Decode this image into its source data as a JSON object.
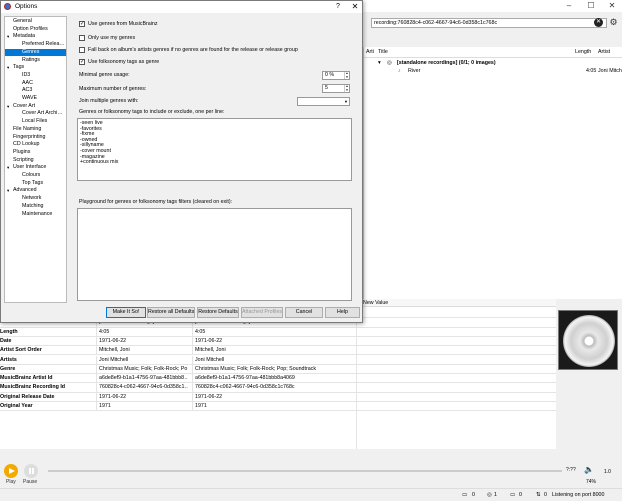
{
  "main": {
    "search_value": "recording:760828c4-c062-4667-94c6-0d358c1c768c",
    "right_columns": [
      "Arti",
      "Title",
      "Length",
      "Artist"
    ],
    "tree_rows": [
      {
        "title": "[standalone recordings] (0/1; 0 images)",
        "length": "",
        "artist": ""
      },
      {
        "title": "River",
        "length": "4:05",
        "artist": "Joni Mitch"
      }
    ],
    "metadata_header_new": "New Value",
    "metadata_rows": [
      {
        "tag": "Artist",
        "orig": "Joni Mitchell",
        "new": "Joni Mitchell"
      },
      {
        "tag": "Album",
        "orig": "[standalone recordings]",
        "new": "[standalone recordings]"
      },
      {
        "tag": "Length",
        "orig": "4:05",
        "new": "4:05"
      },
      {
        "tag": "Date",
        "orig": "1971-06-22",
        "new": "1971-06-22"
      },
      {
        "tag": "Artist Sort Order",
        "orig": "Mitchell, Joni",
        "new": "Mitchell, Joni"
      },
      {
        "tag": "Artists",
        "orig": "Joni Mitchell",
        "new": "Joni Mitchell"
      },
      {
        "tag": "Genre",
        "orig": "Christmas Music; Folk; Folk-Rock; Po…",
        "new": "Christmas Music; Folk; Folk-Rock; Pop; Soundtrack"
      },
      {
        "tag": "MusicBrainz Artist Id",
        "orig": "a6de8ef9-b1a1-4756-97aa-481bbb8…",
        "new": "a6de8ef9-b1a1-4756-97aa-481bbb8a4069"
      },
      {
        "tag": "MusicBrainz Recording Id",
        "orig": "760828c4-c062-4667-94c6-0d358c1…",
        "new": "760828c4-c062-4667-94c6-0d358c1c768c"
      },
      {
        "tag": "Original Release Date",
        "orig": "1971-06-22",
        "new": "1971-06-22"
      },
      {
        "tag": "Original Year",
        "orig": "1971",
        "new": "1971"
      }
    ],
    "player": {
      "play_label": "Play",
      "pause_label": "Pause",
      "time": "?:??",
      "volume": "74%",
      "rate": "1.0"
    },
    "status": {
      "count_a": "0",
      "count_b": "1",
      "count_c": "0",
      "count_d": "0",
      "listening": "Listening on port 8000"
    }
  },
  "dialog": {
    "title": "Options",
    "nav_items": [
      {
        "label": "General",
        "indent": 0,
        "arrow": ""
      },
      {
        "label": "Option Profiles",
        "indent": 0,
        "arrow": ""
      },
      {
        "label": "Metadata",
        "indent": 0,
        "arrow": "▾"
      },
      {
        "label": "Preferred Relea…",
        "indent": 1,
        "arrow": ""
      },
      {
        "label": "Genres",
        "indent": 1,
        "arrow": "",
        "selected": true
      },
      {
        "label": "Ratings",
        "indent": 1,
        "arrow": ""
      },
      {
        "label": "Tags",
        "indent": 0,
        "arrow": "▾"
      },
      {
        "label": "ID3",
        "indent": 1,
        "arrow": ""
      },
      {
        "label": "AAC",
        "indent": 1,
        "arrow": ""
      },
      {
        "label": "AC3",
        "indent": 1,
        "arrow": ""
      },
      {
        "label": "WAVE",
        "indent": 1,
        "arrow": ""
      },
      {
        "label": "Cover Art",
        "indent": 0,
        "arrow": "▾"
      },
      {
        "label": "Cover Art Archi…",
        "indent": 1,
        "arrow": ""
      },
      {
        "label": "Local Files",
        "indent": 1,
        "arrow": ""
      },
      {
        "label": "File Naming",
        "indent": 0,
        "arrow": ""
      },
      {
        "label": "Fingerprinting",
        "indent": 0,
        "arrow": ""
      },
      {
        "label": "CD Lookup",
        "indent": 0,
        "arrow": ""
      },
      {
        "label": "Plugins",
        "indent": 0,
        "arrow": ""
      },
      {
        "label": "Scripting",
        "indent": 0,
        "arrow": ""
      },
      {
        "label": "User Interface",
        "indent": 0,
        "arrow": "▾"
      },
      {
        "label": "Colours",
        "indent": 1,
        "arrow": ""
      },
      {
        "label": "Top Tags",
        "indent": 1,
        "arrow": ""
      },
      {
        "label": "Advanced",
        "indent": 0,
        "arrow": "▾"
      },
      {
        "label": "Network",
        "indent": 1,
        "arrow": ""
      },
      {
        "label": "Matching",
        "indent": 1,
        "arrow": ""
      },
      {
        "label": "Maintenance",
        "indent": 1,
        "arrow": ""
      }
    ],
    "use_genres": {
      "label": "Use genres from MusicBrainz",
      "checked": true
    },
    "only_my_genres": {
      "label": "Only use my genres",
      "checked": false
    },
    "fallback": {
      "label": "Fall back on album's artists genres if no genres are found for the release or release group",
      "checked": false
    },
    "folksonomy": {
      "label": "Use folksonomy tags as genre",
      "checked": true
    },
    "min_usage": {
      "label": "Minimal genre usage:",
      "value": "0 %"
    },
    "max_genres": {
      "label": "Maximum number of genres:",
      "value": "5"
    },
    "join_label": "Join multiple genres with:",
    "filter_label": "Genres or folksonomy tags to include or exclude, one per line:",
    "filter_lines": [
      "-seen live",
      "-favorites",
      "-fixme",
      "-owned",
      "-sillyname",
      "-cover mount",
      "-magazine",
      "+continuous mix"
    ],
    "playground_label": "Playground for genres or folksonomy tags filters (cleared on exit):",
    "buttons": {
      "make_it_so": "Make It So!",
      "restore_all": "Restore all Defaults",
      "restore": "Restore Defaults",
      "attached": "Attached Profiles",
      "cancel": "Cancel",
      "help": "Help"
    }
  }
}
